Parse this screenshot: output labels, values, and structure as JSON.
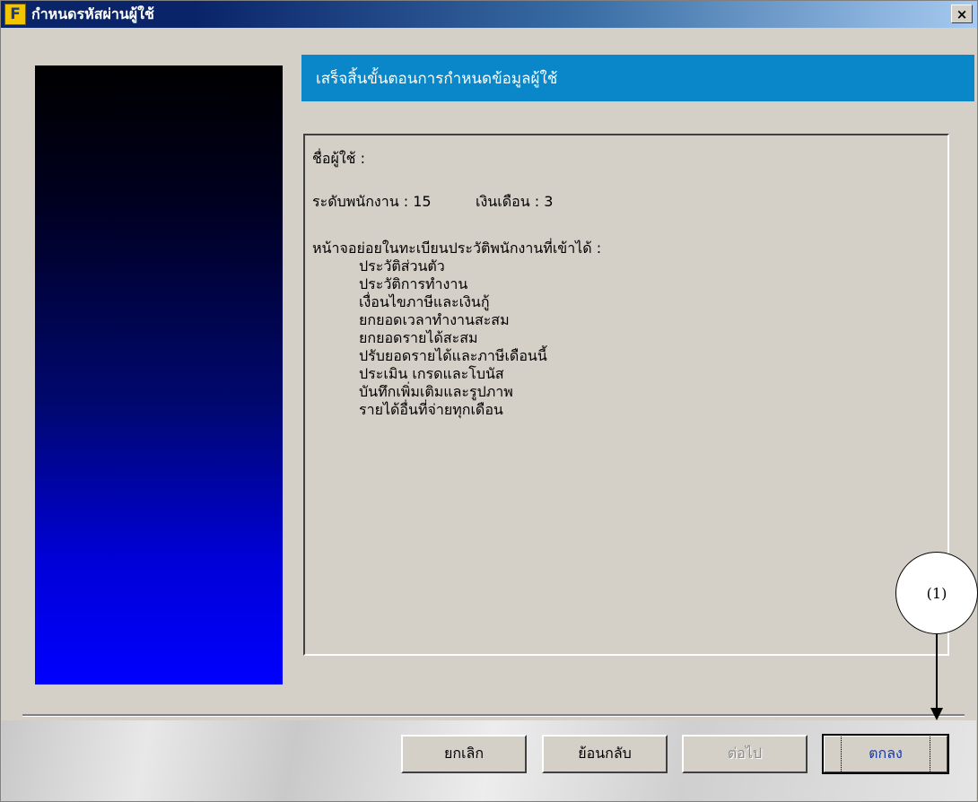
{
  "window": {
    "title": "กำหนดรหัสผ่านผู้ใช้",
    "icon_letter": "F",
    "close_label": "×"
  },
  "header": {
    "text": "เสร็จสิ้นขั้นตอนการกำหนดข้อมูลผู้ใช้"
  },
  "summary": {
    "username_label": "ชื่อผู้ใช้ :",
    "level_label": "ระดับพนักงาน : 15",
    "salary_label": "เงินเดือน : 3",
    "screens_heading": "หน้าจอย่อยในทะเบียนประวัติพนักงานที่เข้าได้ :",
    "screens": [
      "ประวัติส่วนตัว",
      "ประวัติการทำงาน",
      "เงื่อนไขภาษีและเงินกู้",
      "ยกยอดเวลาทำงานสะสม",
      "ยกยอดรายได้สะสม",
      "ปรับยอดรายได้และภาษีเดือนนี้",
      "ประเมิน เกรดและโบนัส",
      "บันทึกเพิ่มเติมและรูปภาพ",
      "รายได้อื่นที่จ่ายทุกเดือน"
    ]
  },
  "buttons": {
    "cancel": "ยกเลิก",
    "back": "ย้อนกลับ",
    "next": "ต่อไป",
    "ok": "ตกลง"
  },
  "annotation": {
    "callout": "(1)"
  },
  "colors": {
    "titlebar_start": "#0a246a",
    "header_banner": "#0a87c8",
    "dialog_bg": "#d4d0c8"
  }
}
